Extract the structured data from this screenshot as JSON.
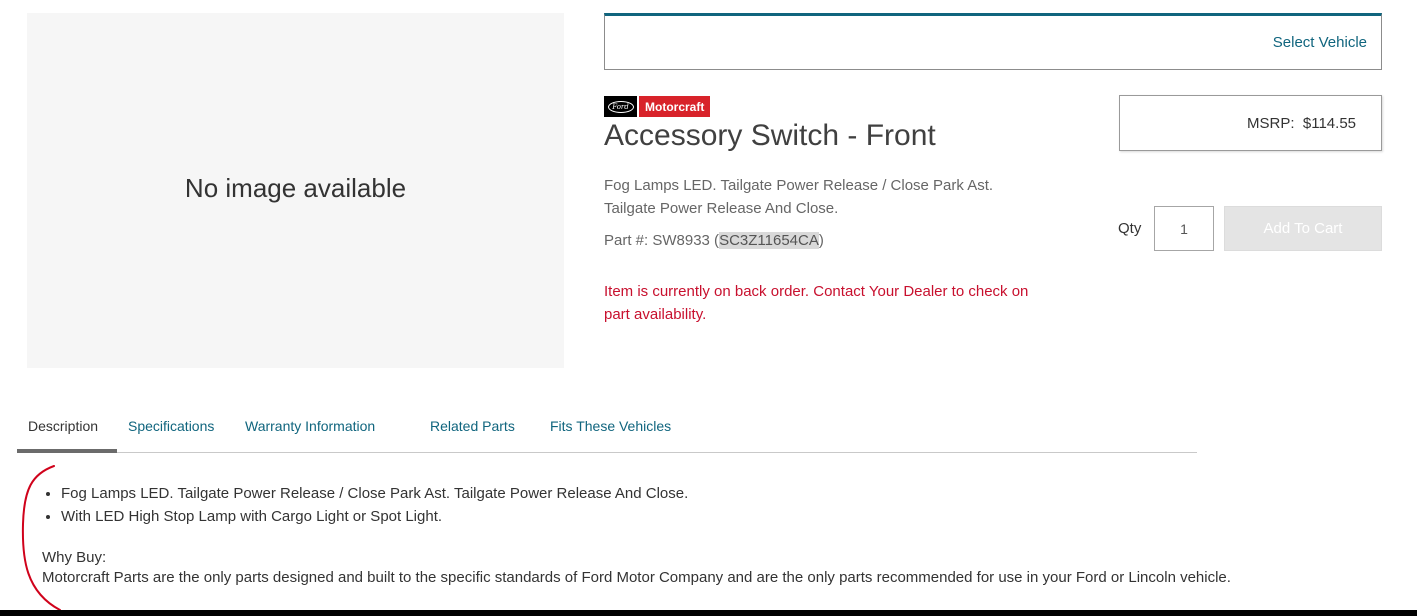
{
  "image_panel": {
    "placeholder_text": "No image available"
  },
  "vehicle": {
    "select_label": "Select Vehicle"
  },
  "brand": {
    "ford_logo_text": "Ford",
    "motorcraft_label": "Motorcraft"
  },
  "product": {
    "title": "Accessory Switch - Front",
    "description_line1": "Fog Lamps LED. Tailgate Power Release / Close Park Ast.",
    "description_line2": "Tailgate Power Release And Close.",
    "part_prefix": "Part #: SW8933 (",
    "part_number": "SC3Z11654CA",
    "part_suffix": ")",
    "backorder_message": "Item is currently on back order. Contact Your Dealer to check on part availability."
  },
  "pricing": {
    "msrp_label": "MSRP:",
    "msrp_value": "$114.55"
  },
  "purchase": {
    "qty_label": "Qty",
    "qty_value": "1",
    "add_to_cart_label": "Add To Cart"
  },
  "tabs": [
    {
      "label": "Description",
      "active": true
    },
    {
      "label": "Specifications",
      "active": false
    },
    {
      "label": "Warranty Information",
      "active": false
    },
    {
      "label": "Related Parts",
      "active": false
    },
    {
      "label": "Fits These Vehicles",
      "active": false
    }
  ],
  "description_tab": {
    "bullets": [
      "Fog Lamps LED. Tailgate Power Release / Close Park Ast. Tailgate Power Release And Close.",
      "With LED High Stop Lamp with Cargo Light or Spot Light."
    ],
    "why_buy_heading": "Why Buy:",
    "why_buy_text": "Motorcraft Parts are the only parts designed and built to the specific standards of Ford Motor Company and are the only parts recommended for use in your Ford or Lincoln vehicle."
  },
  "colors": {
    "link_teal": "#10657e",
    "backorder_red": "#c8102e",
    "motorcraft_red": "#d8232a",
    "annotation_red": "#d0021b"
  }
}
